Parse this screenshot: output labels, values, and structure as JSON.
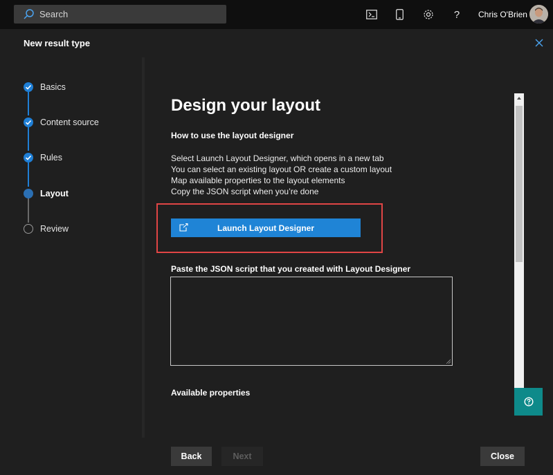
{
  "topbar": {
    "search_placeholder": "Search",
    "icons": [
      "terminal-icon",
      "mobile-icon",
      "gear-icon",
      "help-icon"
    ],
    "user_name": "Chris O'Brien"
  },
  "panel": {
    "title": "New result type"
  },
  "steps": [
    {
      "label": "Basics",
      "state": "done"
    },
    {
      "label": "Content source",
      "state": "done"
    },
    {
      "label": "Rules",
      "state": "done"
    },
    {
      "label": "Layout",
      "state": "current"
    },
    {
      "label": "Review",
      "state": "todo"
    }
  ],
  "content": {
    "heading": "Design your layout",
    "subheading": "How to use the layout designer",
    "instructions": [
      "Select Launch Layout Designer, which opens in a new tab",
      "You can select an existing layout OR create a custom layout",
      "Map available properties to the layout elements",
      "Copy the JSON script when you’re done"
    ],
    "launch_button": "Launch Layout Designer",
    "paste_label": "Paste the JSON script that you created with Layout Designer",
    "json_value": "",
    "available_properties": "Available properties"
  },
  "footer": {
    "back": "Back",
    "next": "Next",
    "close": "Close"
  },
  "colors": {
    "accent": "#1f84d6",
    "highlight_border": "#e04545",
    "help_button": "#0e8a8a"
  }
}
